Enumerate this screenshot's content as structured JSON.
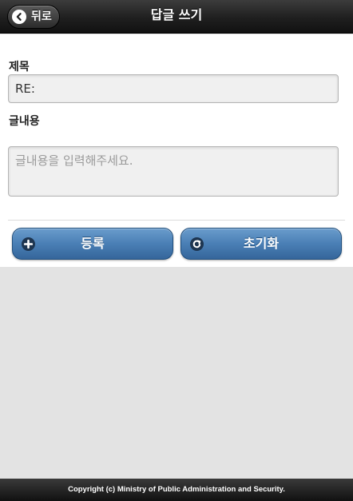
{
  "header": {
    "title": "답글 쓰기",
    "back_label": "뒤로"
  },
  "form": {
    "subject_label": "제목",
    "subject_value": "RE:",
    "content_label": "글내용",
    "content_placeholder": "글내용을 입력해주세요.",
    "content_value": ""
  },
  "actions": {
    "register_label": "등록",
    "register_icon": "plus-icon",
    "reset_label": "초기화",
    "reset_icon": "refresh-icon"
  },
  "footer": {
    "copyright": "Copyright (c) Ministry of Public Administration and Security."
  },
  "colors": {
    "header_bg": "#1f1f1f",
    "button_blue": "#4a7fb5",
    "page_bg": "#e3e3e3"
  }
}
